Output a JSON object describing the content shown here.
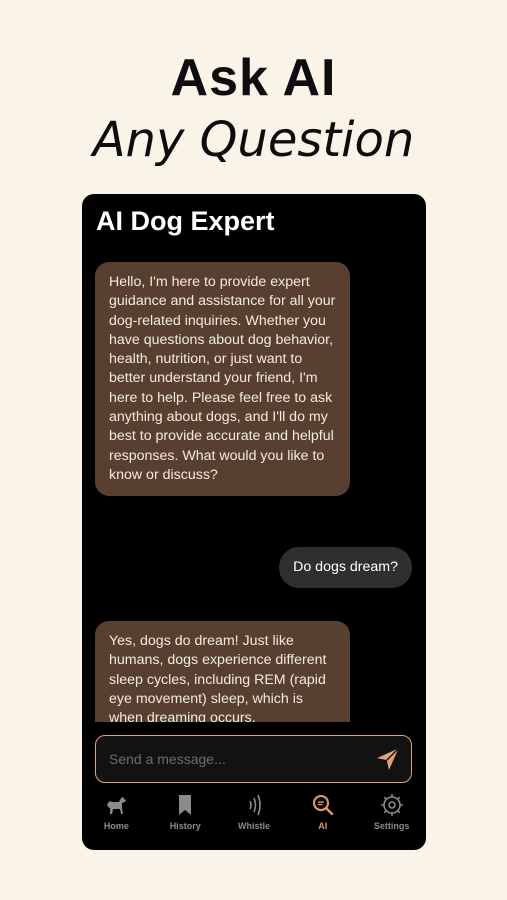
{
  "promo": {
    "headline": "Ask AI",
    "subheadline": "Any Question"
  },
  "screen": {
    "title": "AI Dog Expert"
  },
  "messages": [
    {
      "role": "ai",
      "text": "Hello, I'm here to provide expert guidance and assistance for all your dog-related inquiries. Whether you have questions about dog behavior, health, nutrition, or just want to better understand your friend, I'm here to help. Please feel free to ask anything about dogs, and I'll do my best to provide accurate and helpful responses. What would you like to know or discuss?"
    },
    {
      "role": "user",
      "text": "Do dogs dream?"
    },
    {
      "role": "ai",
      "text": "Yes, dogs do dream! Just like humans, dogs experience different sleep cycles, including REM (rapid eye movement) sleep, which is when dreaming occurs."
    }
  ],
  "composer": {
    "placeholder": "Send a message...",
    "value": ""
  },
  "tabs": [
    {
      "label": "Home",
      "icon": "dog-icon",
      "active": false
    },
    {
      "label": "History",
      "icon": "bookmark-icon",
      "active": false
    },
    {
      "label": "Whistle",
      "icon": "whistle-sound-icon",
      "active": false
    },
    {
      "label": "AI",
      "icon": "search-chat-icon",
      "active": true
    },
    {
      "label": "Settings",
      "icon": "gear-icon",
      "active": false
    }
  ],
  "colors": {
    "background": "#faf3e8",
    "phone": "#000000",
    "ai_bubble": "#574030",
    "user_bubble": "#2f2f2f",
    "accent": "#d9946b",
    "inactive": "#8a8a8a"
  }
}
